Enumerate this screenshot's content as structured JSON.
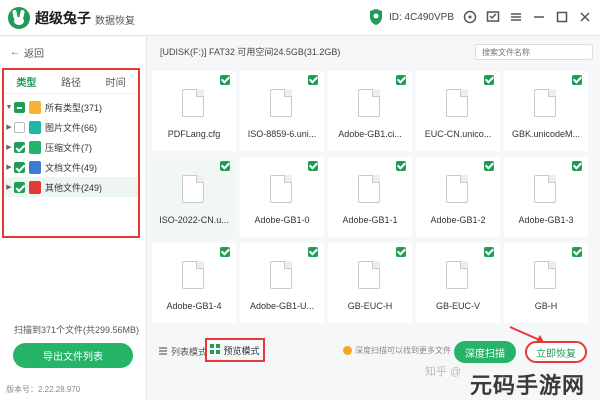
{
  "app": {
    "title": "超级兔子",
    "subtitle": "数据恢复",
    "device_id": "ID: 4C490VPB",
    "colors": {
      "accent": "#1f9d57",
      "highlight": "#e53935",
      "button": "#25b468"
    }
  },
  "sidebar": {
    "back_label": "返回",
    "tabs": [
      {
        "label": "类型"
      },
      {
        "label": "路径"
      },
      {
        "label": "时间"
      }
    ],
    "tree": [
      {
        "label": "所有类型(371)",
        "icon": "folder-icon",
        "color": "#f5b335",
        "check": "part"
      },
      {
        "label": "图片文件(66)",
        "icon": "image-file-icon",
        "color": "#1fb6a7",
        "check": "off"
      },
      {
        "label": "压缩文件(7)",
        "icon": "archive-file-icon",
        "color": "#25b468",
        "check": "on"
      },
      {
        "label": "文档文件(49)",
        "icon": "document-file-icon",
        "color": "#3a7bd5",
        "check": "on"
      },
      {
        "label": "其他文件(249)",
        "icon": "other-file-icon",
        "color": "#e53935",
        "check": "on"
      }
    ],
    "scan_info": "扫描到371个文件(共299.56MB)",
    "export_label": "导出文件列表",
    "version": "版本号：2.22.28.970"
  },
  "main": {
    "path": "[UDISK(F:)] FAT32 可用空间24.5GB(31.2GB)",
    "search_placeholder": "搜索文件名称",
    "files": [
      {
        "name": "PDFLang.cfg"
      },
      {
        "name": "ISO-8859-6.uni..."
      },
      {
        "name": "Adobe-GB1.ci..."
      },
      {
        "name": "EUC-CN.unico..."
      },
      {
        "name": "GBK.unicodeM..."
      },
      {
        "name": "ISO-2022-CN.u..."
      },
      {
        "name": "Adobe-GB1-0"
      },
      {
        "name": "Adobe-GB1-1"
      },
      {
        "name": "Adobe-GB1-2"
      },
      {
        "name": "Adobe-GB1-3"
      },
      {
        "name": "Adobe-GB1-4"
      },
      {
        "name": "Adobe-GB1-U..."
      },
      {
        "name": "GB-EUC-H"
      },
      {
        "name": "GB-EUC-V"
      },
      {
        "name": "GB-H"
      }
    ],
    "list_mode_label": "列表模式",
    "preview_mode_label": "预览模式",
    "tip": "深度扫描可以找到更多文件",
    "deep_scan_label": "深度扫描",
    "recover_label": "立即恢复"
  },
  "watermark": "知乎 @",
  "brand": "元码手游网"
}
